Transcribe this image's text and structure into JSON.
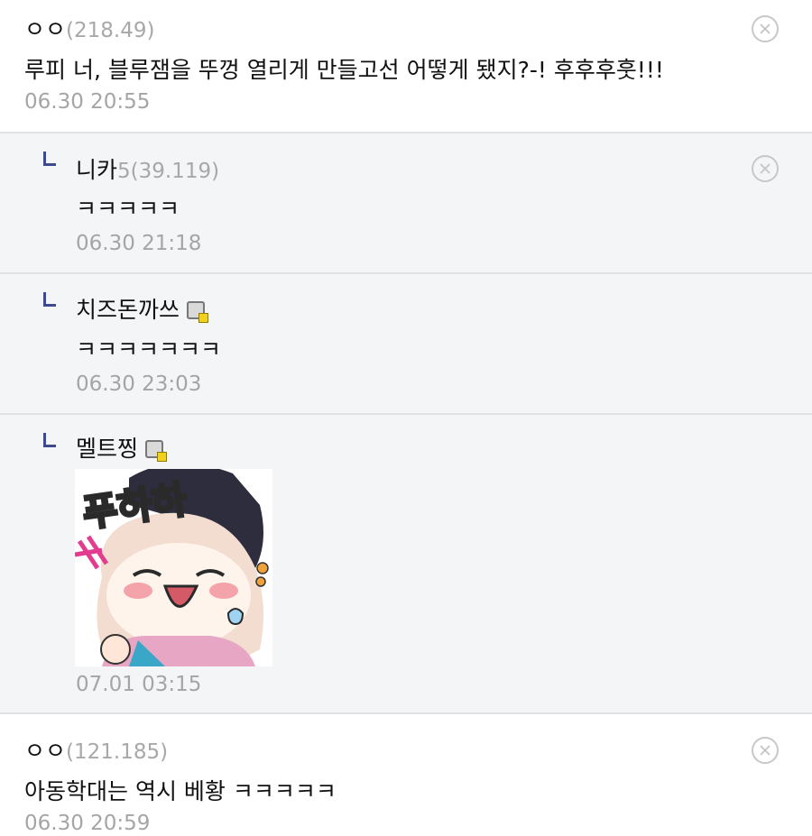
{
  "comments": [
    {
      "nick": "ㅇㅇ",
      "ip": "(218.49)",
      "text": "루피 너, 블루잼을 뚜껑 열리게 만들고선 어떻게 됐지?-! 후후후훗!!!",
      "time": "06.30 20:55"
    },
    {
      "nick": "니카",
      "ip": "5(39.119)",
      "text": "ㅋㅋㅋㅋㅋ",
      "time": "06.30 21:18"
    },
    {
      "nick": "치즈돈까쓰",
      "text": "ㅋㅋㅋㅋㅋㅋㅋ",
      "time": "06.30 23:03"
    },
    {
      "nick": "멜트찡",
      "sticker_text": "푸하하",
      "time": "07.01 03:15"
    },
    {
      "nick": "ㅇㅇ",
      "ip": "(121.185)",
      "text": "아동학대는 역시 베황 ㅋㅋㅋㅋㅋ",
      "time": "06.30 20:59"
    }
  ],
  "icons": {
    "delete": "close-circle-icon",
    "reply": "reply-arrow-icon",
    "fixed_nick": "fixed-nick-icon"
  },
  "colors": {
    "reply_bg": "#f4f5f7",
    "reply_mark": "#3f4a8e",
    "meta": "#a5a5a5"
  }
}
